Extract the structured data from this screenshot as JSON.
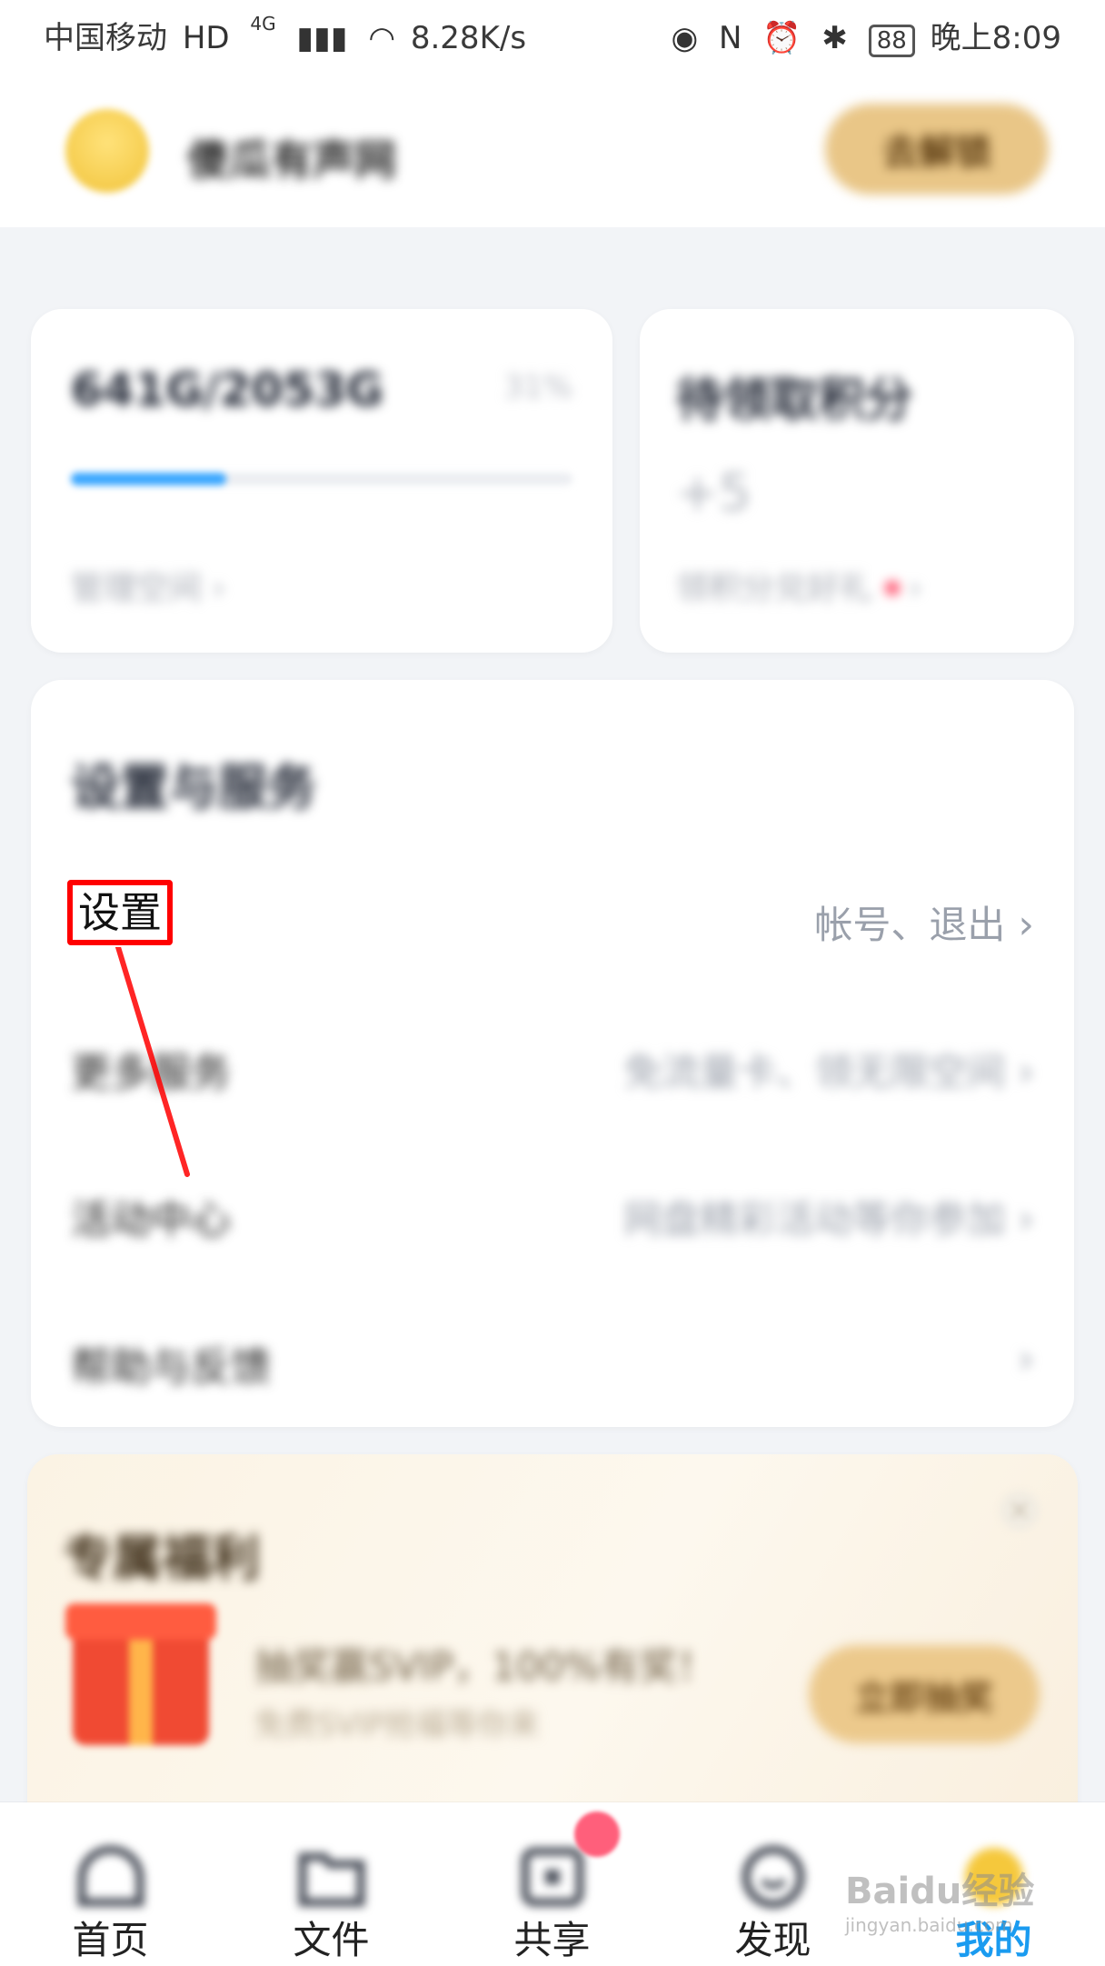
{
  "status_bar": {
    "carrier": "中国移动",
    "network": "4G",
    "speed": "8.28K/s",
    "battery": "88",
    "time": "晚上8:09"
  },
  "header": {
    "username": "傻瓜有声网",
    "vip_button": "去解锁"
  },
  "storage": {
    "amount": "641G/2053G",
    "percent_text": "31%",
    "percent_value": 0.31,
    "link": "管理空间"
  },
  "points": {
    "title": "待领取积分",
    "value": "+5",
    "link": "领积分兑好礼"
  },
  "services": {
    "title": "设置与服务",
    "rows": [
      {
        "label": "设置",
        "detail": "帐号、退出"
      },
      {
        "label": "更多服务",
        "detail": "免流量卡、领无限空间"
      },
      {
        "label": "活动中心",
        "detail": "网盘精彩活动等你参加"
      },
      {
        "label": "帮助与反馈",
        "detail": ""
      }
    ]
  },
  "benefits": {
    "title": "专属福利",
    "text": "抽奖赢SVIP，100%有奖！",
    "sub": "免费SVIP抢福等你来",
    "button": "立即抽奖"
  },
  "nav": {
    "tabs": [
      {
        "label": "首页",
        "icon": "home-icon"
      },
      {
        "label": "文件",
        "icon": "folder-icon"
      },
      {
        "label": "共享",
        "icon": "share-icon"
      },
      {
        "label": "发现",
        "icon": "discover-icon"
      },
      {
        "label": "我的",
        "icon": "profile-icon"
      }
    ]
  },
  "watermark": {
    "brand": "Baidu经验",
    "url": "jingyan.baidu.com"
  },
  "colors": {
    "accent": "#1a9bf0",
    "annotation": "#ff0000",
    "vip_gold": "#e9c687"
  }
}
